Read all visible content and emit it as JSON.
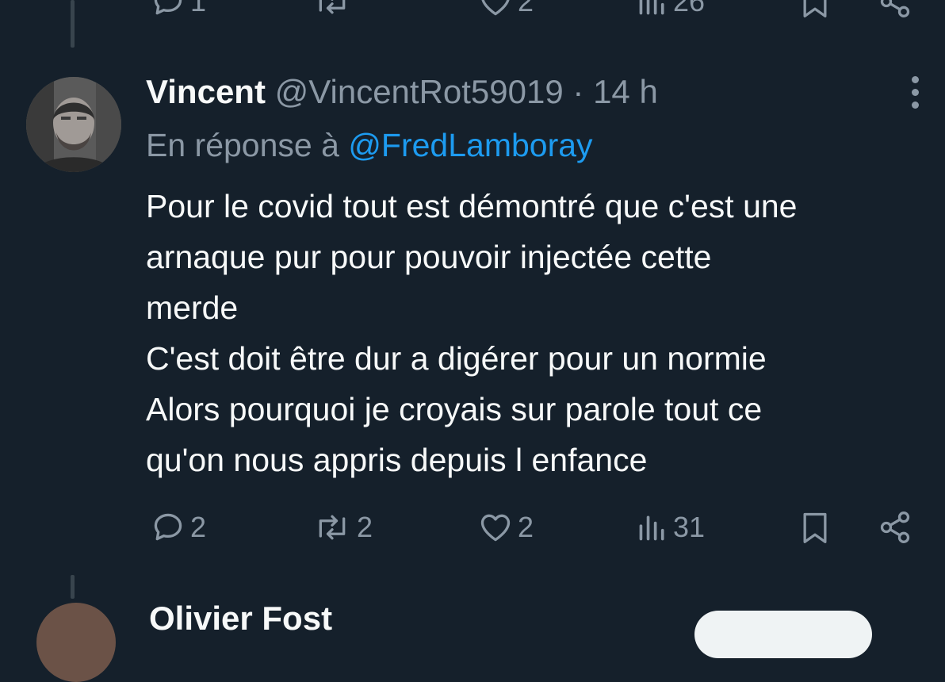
{
  "prev_tweet": {
    "actions": {
      "replies": "1",
      "retweets": "",
      "likes": "2",
      "views": "26"
    }
  },
  "tweet": {
    "name": "Vincent",
    "handle": "@VincentRot59019",
    "separator": "·",
    "time": "14 h",
    "reply_prefix": "En réponse à",
    "reply_to": "@FredLamboray",
    "body_lines": [
      "Pour le covid tout est démontré que c'est une",
      "arnaque pur pour pouvoir injectée cette",
      "merde",
      "C'est doit être dur a digérer pour un normie",
      "Alors pourquoi je croyais sur parole tout ce",
      "qu'on nous appris depuis l enfance"
    ],
    "actions": {
      "replies": "2",
      "retweets": "2",
      "likes": "2",
      "views": "31"
    }
  },
  "next_tweet": {
    "name": "Olivier Fost"
  },
  "icons": {
    "reply": "reply-icon",
    "retweet": "retweet-icon",
    "like": "heart-icon",
    "views": "views-icon",
    "bookmark": "bookmark-icon",
    "share": "share-icon",
    "more": "more-icon"
  },
  "colors": {
    "background": "#15202b",
    "text": "#f7f9f9",
    "muted": "#8b98a5",
    "link": "#1d9bf0"
  }
}
